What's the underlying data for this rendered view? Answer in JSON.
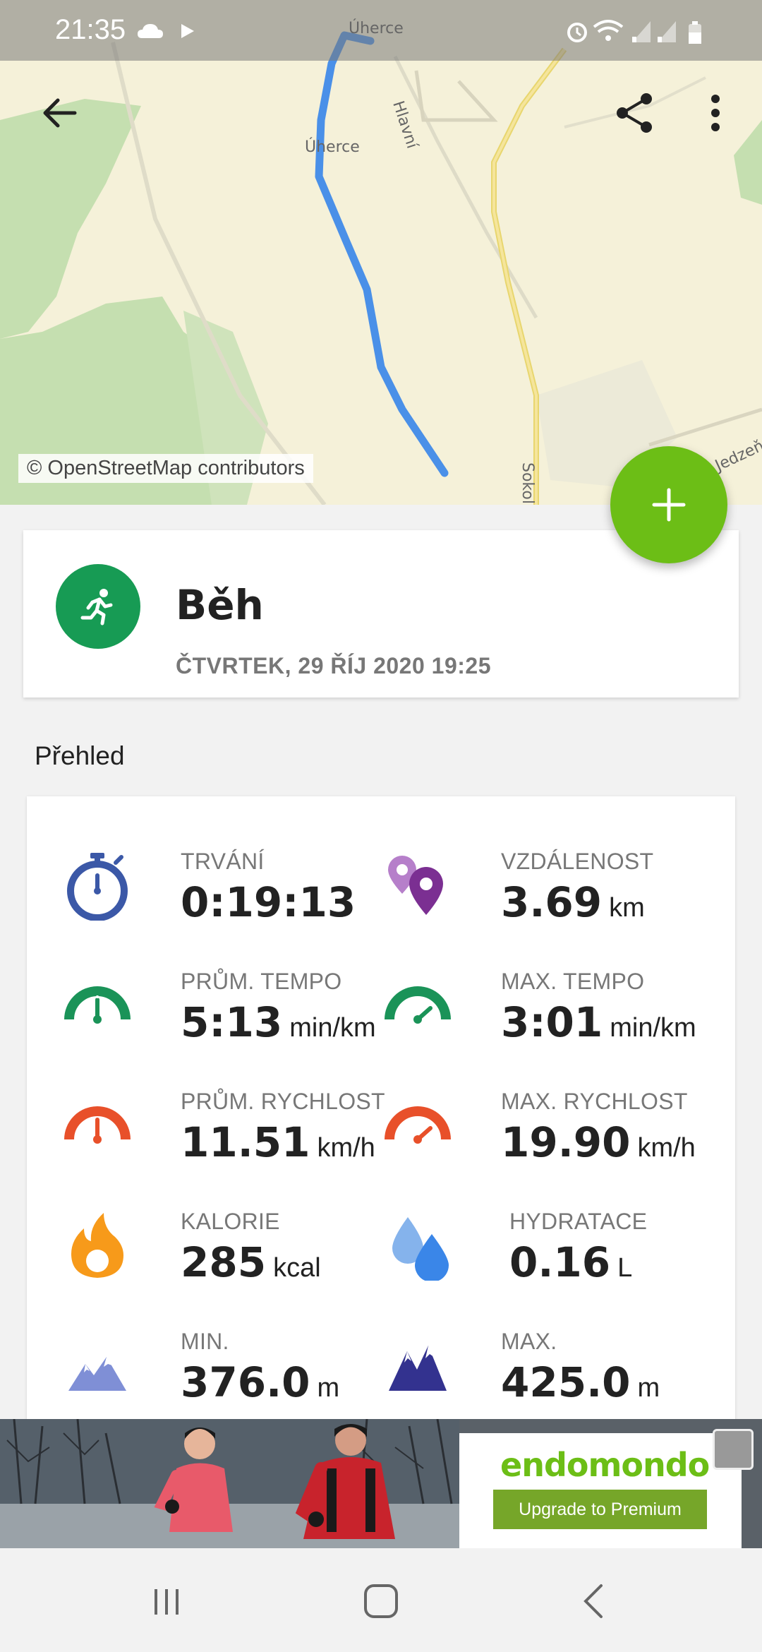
{
  "status_bar": {
    "time": "21:35",
    "left_icons": [
      "cloud-icon",
      "play-icon"
    ],
    "right_icons": [
      "alarm-icon",
      "wifi-icon",
      "signal-icon",
      "signal-icon",
      "battery-icon"
    ]
  },
  "map": {
    "labels": [
      "Úherce",
      "Úherce",
      "Hlavní",
      "Sokol",
      "Jedzeňská"
    ],
    "credit": "© OpenStreetMap contributors",
    "route_color": "#4a90e8"
  },
  "toolbar": {
    "back_icon": "arrow-left-icon",
    "share_icon": "share-icon",
    "menu_icon": "more-vertical-icon"
  },
  "fab": {
    "icon": "plus-icon",
    "color": "#6cbe16"
  },
  "activity": {
    "sport": "Běh",
    "date": "ČTVRTEK, 29 ŘÍJ 2020 19:25",
    "icon": "running-icon",
    "color": "#179b54"
  },
  "overview": {
    "title": "Přehled",
    "stats": [
      {
        "label": "TRVÁNÍ",
        "value": "0:19:13",
        "unit": "",
        "icon": "stopwatch-icon"
      },
      {
        "label": "VZDÁLENOST",
        "value": "3.69",
        "unit": "km",
        "icon": "pins-icon"
      },
      {
        "label": "PRŮM. TEMPO",
        "value": "5:13",
        "unit": "min/km",
        "icon": "gauge-green-icon"
      },
      {
        "label": "MAX. TEMPO",
        "value": "3:01",
        "unit": "min/km",
        "icon": "gauge-green-max-icon"
      },
      {
        "label": "PRŮM. RYCHLOST",
        "value": "11.51",
        "unit": "km/h",
        "icon": "gauge-red-icon"
      },
      {
        "label": "MAX. RYCHLOST",
        "value": "19.90",
        "unit": "km/h",
        "icon": "gauge-red-max-icon"
      },
      {
        "label": "KALORIE",
        "value": "285",
        "unit": "kcal",
        "icon": "fire-icon"
      },
      {
        "label": "HYDRATACE",
        "value": "0.16",
        "unit": "L",
        "icon": "water-drops-icon"
      },
      {
        "label": "MIN.",
        "value": "376.0",
        "unit": "m",
        "icon": "mountain-light-icon"
      },
      {
        "label": "MAX.",
        "value": "425.0",
        "unit": "m",
        "icon": "mountain-dark-icon"
      }
    ]
  },
  "ad": {
    "brand": "endomondo",
    "cta": "Upgrade to Premium"
  },
  "navbar": {
    "icons": [
      "recents-icon",
      "home-icon",
      "back-icon"
    ]
  }
}
